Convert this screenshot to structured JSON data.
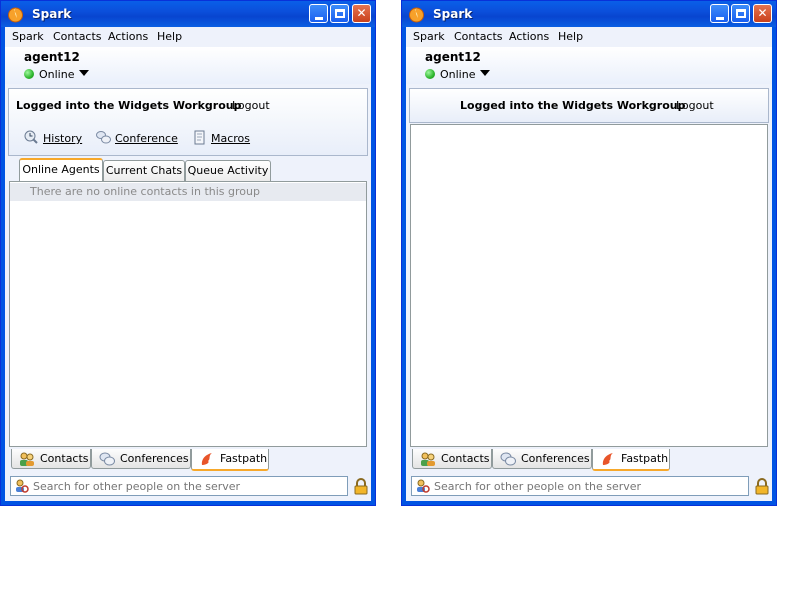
{
  "app": {
    "title": "Spark",
    "menu": [
      "Spark",
      "Contacts",
      "Actions",
      "Help"
    ],
    "username": "agent12",
    "status": "Online",
    "colors": {
      "title_bar": "#0b4fdb",
      "accent_tab": "#f7a82a",
      "status_online": "#2db62d"
    }
  },
  "left_window": {
    "header": {
      "logged_in": "Logged into the Widgets Workgroup",
      "logout": "Logout"
    },
    "tools": [
      {
        "label": "History",
        "icon": "history-icon"
      },
      {
        "label": "Conference",
        "icon": "conference-icon"
      },
      {
        "label": "Macros",
        "icon": "macros-icon"
      }
    ],
    "tabs": [
      "Online Agents",
      "Current Chats",
      "Queue Activity"
    ],
    "active_tab": "Online Agents",
    "empty_message": "There are no online contacts in this group"
  },
  "right_window": {
    "header": {
      "logged_in": "Logged into the Widgets Workgroup",
      "logout": "Logout"
    }
  },
  "bottom_tabs": [
    {
      "label": "Contacts",
      "icon": "contacts-icon"
    },
    {
      "label": "Conferences",
      "icon": "conferences-icon"
    },
    {
      "label": "Fastpath",
      "icon": "fastpath-icon"
    }
  ],
  "active_bottom_tab": "Fastpath",
  "search": {
    "placeholder": "Search for other people on the server"
  }
}
